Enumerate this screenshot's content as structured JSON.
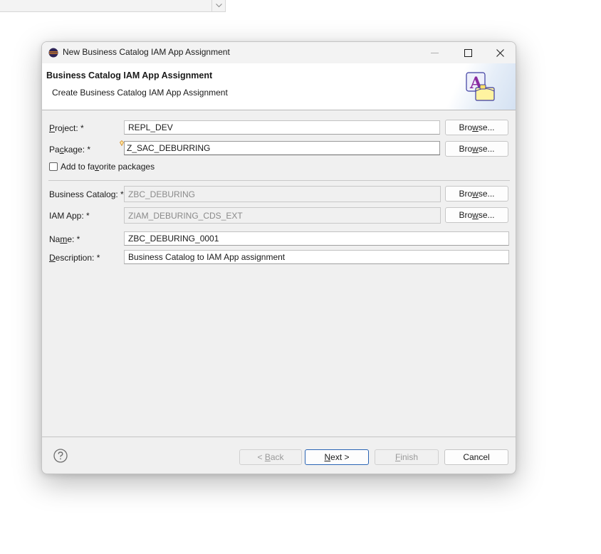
{
  "dialog": {
    "title": "New Business Catalog IAM App Assignment",
    "header_title": "Business Catalog IAM App Assignment",
    "header_subtitle": "Create Business Catalog IAM App Assignment"
  },
  "form": {
    "project": {
      "label_pre": "",
      "label_key": "P",
      "label_post": "roject: *",
      "value": "REPL_DEV"
    },
    "package": {
      "label_pre": "Pa",
      "label_key": "c",
      "label_post": "kage: *",
      "value": "Z_SAC_DEBURRING"
    },
    "favorite": {
      "label_pre": "Add to fa",
      "label_key": "v",
      "label_post": "orite packages",
      "checked": false
    },
    "business_catalog": {
      "label": "Business Catalog: *",
      "value": "ZBC_DEBURING"
    },
    "iam_app": {
      "label": "IAM App: *",
      "value": "ZIAM_DEBURING_CDS_EXT"
    },
    "name": {
      "label_pre": "Na",
      "label_key": "m",
      "label_post": "e: *",
      "value": "ZBC_DEBURING_0001"
    },
    "description": {
      "label_pre": "",
      "label_key": "D",
      "label_post": "escription: *",
      "value": "Business Catalog to IAM App assignment"
    },
    "browse": {
      "pre": "Bro",
      "key": "w",
      "post": "se..."
    }
  },
  "footer": {
    "back": {
      "pre": "< ",
      "key": "B",
      "post": "ack"
    },
    "next": {
      "pre": "",
      "key": "N",
      "post": "ext >"
    },
    "finish": {
      "pre": "",
      "key": "F",
      "post": "inish"
    },
    "cancel": "Cancel"
  },
  "colors": {
    "accent": "#2a64b4",
    "dialog_bg": "#f0f0f0"
  }
}
